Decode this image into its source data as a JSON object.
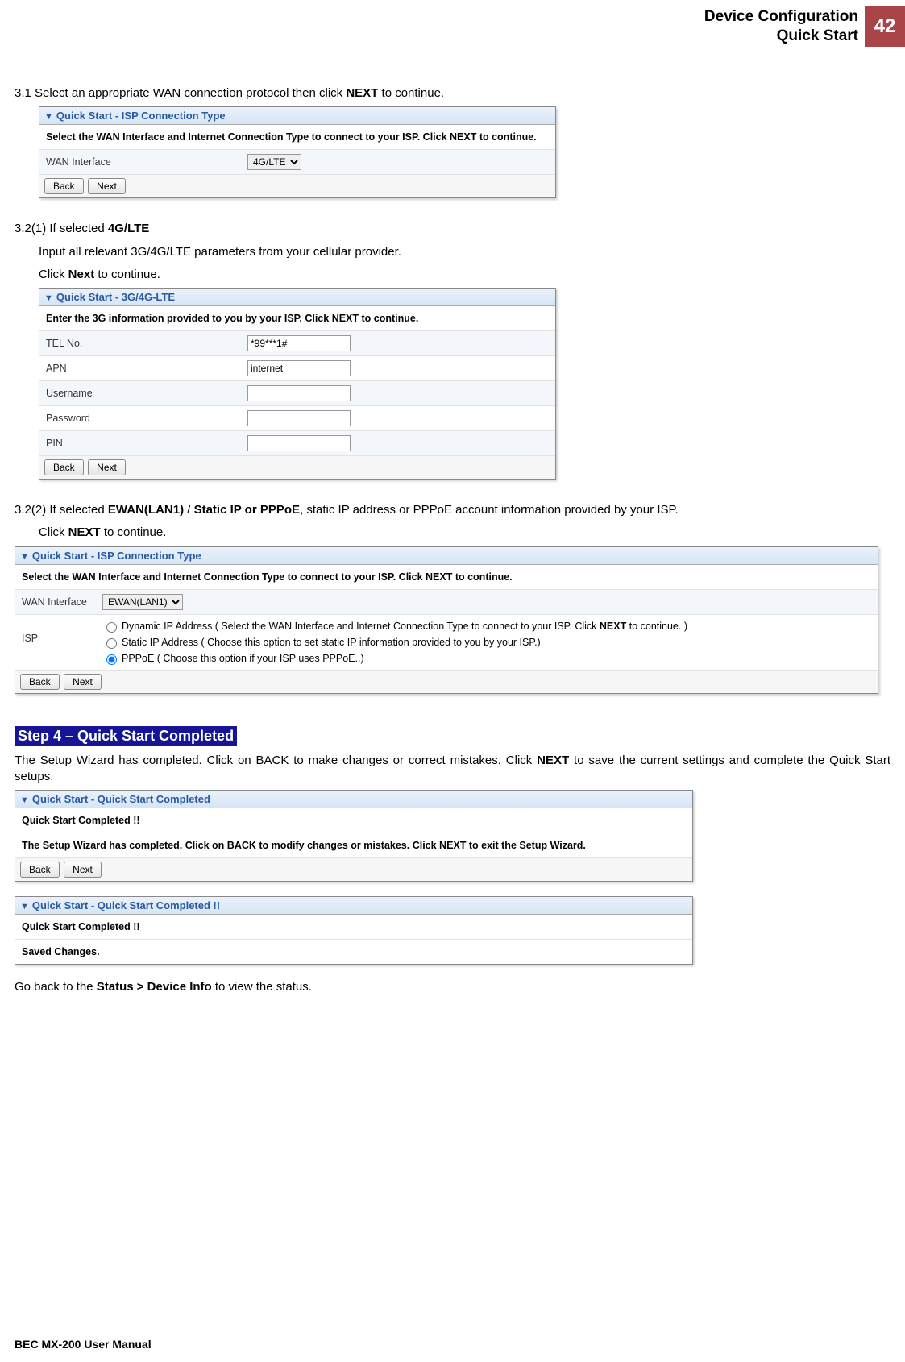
{
  "header": {
    "line1": "Device Configuration",
    "line2": "Quick Start",
    "page_number": "42"
  },
  "s31": {
    "text_pre": "3.1 Select an appropriate WAN connection protocol then click ",
    "text_bold": "NEXT",
    "text_post": " to continue."
  },
  "panel1": {
    "title": "Quick Start - ISP Connection Type",
    "instruction": "Select the WAN Interface and Internet Connection Type to connect to your ISP. Click NEXT to continue.",
    "wan_label": "WAN Interface",
    "wan_value": "4G/LTE",
    "back": "Back",
    "next": "Next"
  },
  "s321": {
    "heading_pre": "3.2(1)  If selected ",
    "heading_bold": "4G/LTE",
    "line1": "Input all relevant 3G/4G/LTE parameters from your cellular provider.",
    "line2_pre": "Click ",
    "line2_bold": "Next",
    "line2_post": " to continue."
  },
  "panel2": {
    "title": "Quick Start - 3G/4G-LTE",
    "instruction": "Enter the 3G information provided to you by your ISP. Click NEXT to continue.",
    "rows": {
      "tel_label": "TEL No.",
      "tel_value": "*99***1#",
      "apn_label": "APN",
      "apn_value": "internet",
      "user_label": "Username",
      "user_value": "",
      "pass_label": "Password",
      "pass_value": "",
      "pin_label": "PIN",
      "pin_value": ""
    },
    "back": "Back",
    "next": "Next"
  },
  "s322": {
    "pre": "3.2(2)   If selected ",
    "b1": "EWAN(LAN1)",
    "mid1": " / ",
    "b2": "Static IP or PPPoE",
    "post": ", static IP address or PPPoE account information provided by your ISP.",
    "line2_pre": "Click ",
    "line2_bold": "NEXT",
    "line2_post": " to continue."
  },
  "panel3": {
    "title": "Quick Start - ISP Connection Type",
    "instruction": "Select the WAN Interface and Internet Connection Type to connect to your ISP. Click NEXT to continue.",
    "wan_label": "WAN Interface",
    "wan_value": "EWAN(LAN1)",
    "isp_label": "ISP",
    "opt1_pre": "Dynamic IP Address ( Select the WAN Interface and Internet Connection Type to connect to your ISP. Click ",
    "opt1_bold": "NEXT",
    "opt1_post": " to continue. )",
    "opt2": "Static IP Address ( Choose this option to set static IP information provided to you by your ISP.)",
    "opt3": "PPPoE ( Choose this option if your ISP uses PPPoE..)",
    "back": "Back",
    "next": "Next"
  },
  "step4": {
    "banner": "Step 4 – Quick Start Completed",
    "para_pre": "The Setup Wizard has completed. Click on BACK to make changes or correct mistakes. Click ",
    "para_bold": "NEXT",
    "para_post": " to save the current settings and complete the Quick Start setups."
  },
  "panel4": {
    "title": "Quick Start - Quick Start Completed",
    "line1": "Quick Start Completed !!",
    "line2": "The Setup Wizard has completed. Click on BACK to modify changes or mistakes. Click NEXT to exit the Setup Wizard.",
    "back": "Back",
    "next": "Next"
  },
  "panel5": {
    "title": "Quick Start - Quick Start Completed !!",
    "line1": "Quick Start Completed !!",
    "line2": "Saved Changes."
  },
  "closing": {
    "pre": "Go back to the ",
    "bold": "Status > Device Info",
    "post": " to view the status."
  },
  "footer": "BEC MX-200 User Manual"
}
